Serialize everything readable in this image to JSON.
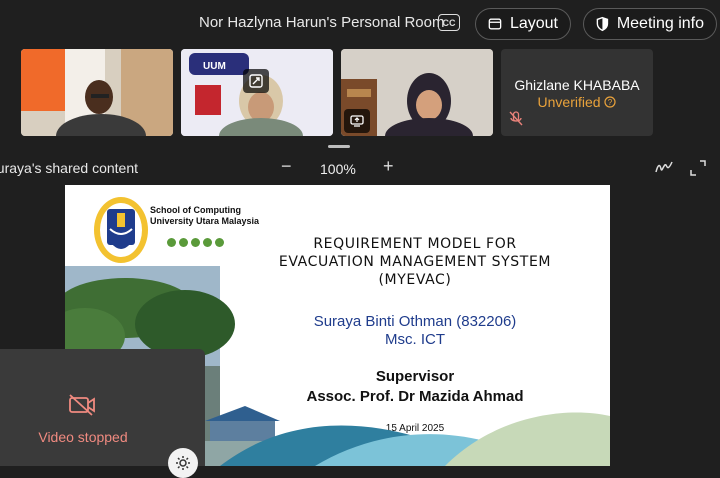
{
  "header": {
    "room_title": "Nor Hazlyna Harun's Personal Room",
    "cc_label": "CC",
    "layout_label": "Layout",
    "meeting_info_label": "Meeting info",
    "layout_icon": "layout-icon",
    "meeting_info_icon": "shield-icon"
  },
  "participants": [
    {
      "type": "video"
    },
    {
      "type": "video",
      "badge": "UUM"
    },
    {
      "type": "video"
    },
    {
      "type": "avatar",
      "name": "Ghizlane KHABABA",
      "status": "Unverified",
      "muted": true
    }
  ],
  "share": {
    "label": "ng Suraya's shared content",
    "zoom_minus": "−",
    "zoom_level": "100%",
    "zoom_plus": "+"
  },
  "slide": {
    "school_line1": "School of Computing",
    "school_line2": "University Utara Malaysia",
    "title_line1": "REQUIREMENT MODEL FOR",
    "title_line2": "EVACUATION MANAGEMENT SYSTEM",
    "title_line3": "(MYEVAC)",
    "author_name": "Suraya Binti Othman (832206)",
    "author_program": "Msc. ICT",
    "supervisor_label": "Supervisor",
    "supervisor_name": "Assoc. Prof. Dr Mazida Ahmad",
    "date": "15 April 2025"
  },
  "self_view": {
    "status": "Video stopped"
  },
  "colors": {
    "unverified": "#e9a23b",
    "video_stopped": "#f08a80",
    "author_blue": "#1f3c8c",
    "dots_green": "#5a9a3a"
  }
}
